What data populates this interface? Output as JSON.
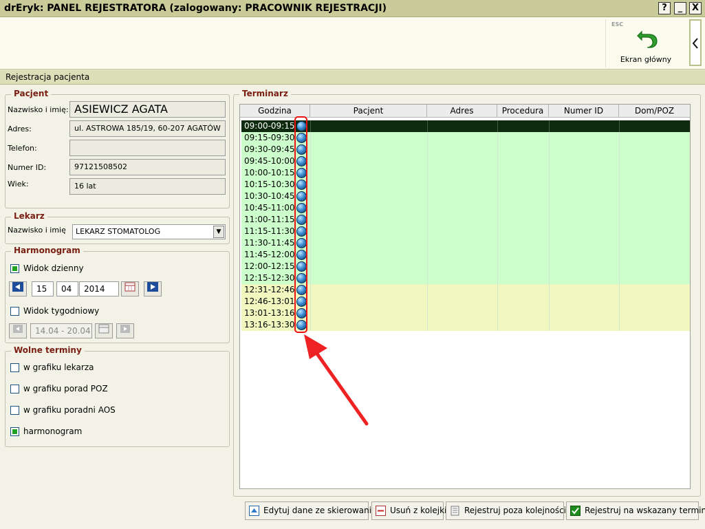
{
  "window": {
    "title": "drEryk: PANEL REJESTRATORA (zalogowany: PRACOWNIK REJESTRACJI)"
  },
  "title_buttons": {
    "help": "?",
    "minimize": "_",
    "close": "X"
  },
  "toolbar": {
    "esc_label": "ESC",
    "home_label": "Ekran główny"
  },
  "section": {
    "title": "Rejestracja pacjenta"
  },
  "patient": {
    "legend": "Pacjent",
    "name_label": "Nazwisko i imię:",
    "name_value": "ASIEWICZ AGATA",
    "address_label": "Adres:",
    "address_value": "ul. ASTROWA 185/19, 60-207 AGATÓW",
    "phone_label": "Telefon:",
    "phone_value": "",
    "id_label": "Numer ID:",
    "id_value": "97121508502",
    "age_label": "Wiek:",
    "age_value": "16 lat"
  },
  "doctor": {
    "legend": "Lekarz",
    "name_label": "Nazwisko i imię",
    "selected": "LEKARZ STOMATOLOG"
  },
  "harmonogram": {
    "legend": "Harmonogram",
    "daily_label": "Widok dzienny",
    "daily_checked": true,
    "day": "15",
    "month": "04",
    "year": "2014",
    "weekly_label": "Widok tygodniowy",
    "weekly_checked": false,
    "week_range": "14.04 - 20.04"
  },
  "free_slots": {
    "legend": "Wolne terminy",
    "options": [
      {
        "label": "w grafiku lekarza",
        "checked": false
      },
      {
        "label": "w grafiku porad POZ",
        "checked": false
      },
      {
        "label": "w grafiku poradni AOS",
        "checked": false
      },
      {
        "label": "harmonogram",
        "checked": true
      }
    ]
  },
  "terminarz": {
    "legend": "Terminarz",
    "columns": [
      "Godzina",
      "Pacjent",
      "Adres",
      "Procedura",
      "Numer ID",
      "Dom/POZ"
    ],
    "rows": [
      {
        "time": "09:00-09:15",
        "status": "selected"
      },
      {
        "time": "09:15-09:30",
        "status": "green"
      },
      {
        "time": "09:30-09:45",
        "status": "green"
      },
      {
        "time": "09:45-10:00",
        "status": "green"
      },
      {
        "time": "10:00-10:15",
        "status": "green"
      },
      {
        "time": "10:15-10:30",
        "status": "green"
      },
      {
        "time": "10:30-10:45",
        "status": "green"
      },
      {
        "time": "10:45-11:00",
        "status": "green"
      },
      {
        "time": "11:00-11:15",
        "status": "green"
      },
      {
        "time": "11:15-11:30",
        "status": "green"
      },
      {
        "time": "11:30-11:45",
        "status": "green"
      },
      {
        "time": "11:45-12:00",
        "status": "green"
      },
      {
        "time": "12:00-12:15",
        "status": "green"
      },
      {
        "time": "12:15-12:30",
        "status": "green"
      },
      {
        "time": "12:31-12:46",
        "status": "yellow"
      },
      {
        "time": "12:46-13:01",
        "status": "yellow"
      },
      {
        "time": "13:01-13:16",
        "status": "yellow"
      },
      {
        "time": "13:16-13:30",
        "status": "yellow"
      }
    ]
  },
  "actions": {
    "edit": "Edytuj dane ze skierowania",
    "remove": "Usuń z kolejki",
    "register_outside": "Rejestruj poza kolejnością",
    "register_slot": "Rejestruj na wskazany termin"
  },
  "colors": {
    "title_bar": "#c9cc98",
    "selected_row": "#0e2a0e",
    "free_row": "#ccffcc",
    "yellow_row": "#f0f7bf",
    "legend": "#7a1e12",
    "annotation": "#ee2222"
  }
}
